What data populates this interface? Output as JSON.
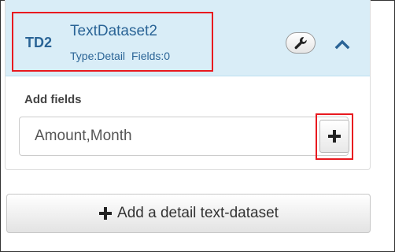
{
  "dataset": {
    "code": "TD2",
    "name": "TextDataset2",
    "type_text": "Type:Detail",
    "fields_text": "Fields:0"
  },
  "add_fields": {
    "label": "Add fields",
    "input_value": "Amount,Month"
  },
  "actions": {
    "add_detail_label": "Add a detail text-dataset"
  },
  "icons": {
    "settings": "wrench-icon",
    "collapse": "chevron-up-icon",
    "add_field": "plus-icon",
    "add_dataset": "plus-icon"
  },
  "colors": {
    "header_background": "#d9edf7",
    "header_text": "#2a6496",
    "highlight": "#e8191f"
  }
}
